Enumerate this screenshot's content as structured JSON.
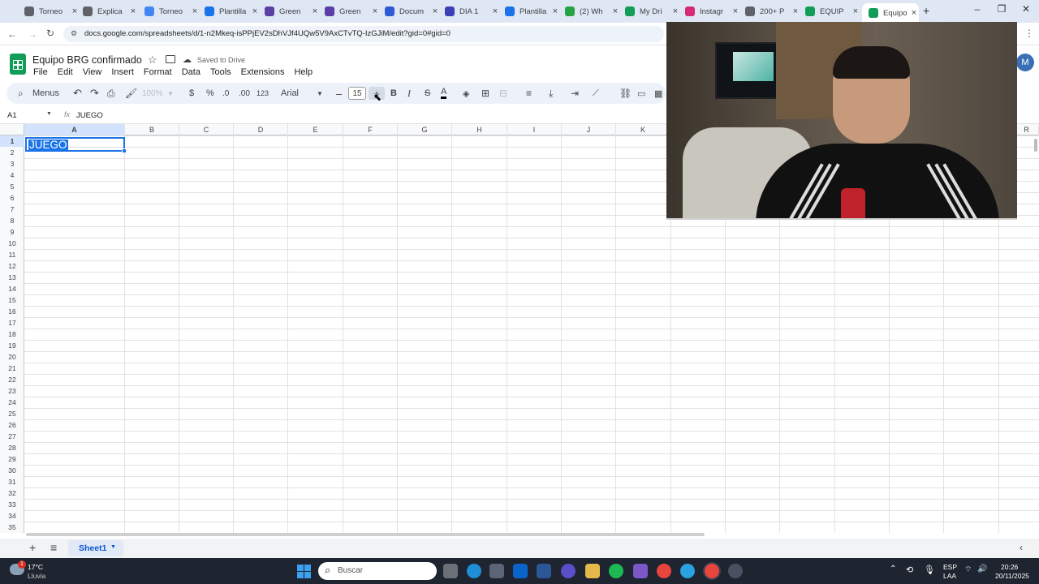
{
  "browser": {
    "tabs": [
      {
        "label": "Torneo",
        "color": "#5f6368"
      },
      {
        "label": "Explica",
        "color": "#5f6368"
      },
      {
        "label": "Torneo",
        "color": "#4285f4"
      },
      {
        "label": "Plantilla",
        "color": "#1a73e8"
      },
      {
        "label": "Green",
        "color": "#5b3fa6"
      },
      {
        "label": "Green",
        "color": "#5b3fa6"
      },
      {
        "label": "Docum",
        "color": "#2c5bd4"
      },
      {
        "label": "DIA 1",
        "color": "#3b3fb5"
      },
      {
        "label": "Plantilla",
        "color": "#1a73e8"
      },
      {
        "label": "(2) Wh",
        "color": "#25a244"
      },
      {
        "label": "My Dri",
        "color": "#0f9d58"
      },
      {
        "label": "Instagr",
        "color": "#d62976"
      },
      {
        "label": "200+ P",
        "color": "#5f6368"
      },
      {
        "label": "EQUIP",
        "color": "#0f9d58"
      },
      {
        "label": "Equipo",
        "color": "#0f9d58"
      }
    ],
    "new_tab": "+",
    "url": "docs.google.com/spreadsheets/d/1-n2Mkeq-isPPjEV2sDhVJf4UQw5V9AxCTvTQ-IzGJiM/edit?gid=0#gid=0"
  },
  "sheet": {
    "title": "Equipo BRG confirmado",
    "saved": "Saved to Drive",
    "menu": [
      "File",
      "Edit",
      "View",
      "Insert",
      "Format",
      "Data",
      "Tools",
      "Extensions",
      "Help"
    ]
  },
  "toolbar": {
    "search": "Menus",
    "zoom": "100%",
    "currency": "$",
    "percent": "%",
    "dec_less": ".0",
    "dec_more": ".00",
    "num_format": "123",
    "font": "Arial",
    "font_size": "15",
    "bold": "B",
    "italic": "I",
    "strike": "S",
    "text_color": "A"
  },
  "formula": {
    "cell_ref": "A1",
    "fx": "fx",
    "value": "JUEGO"
  },
  "columns": [
    "A",
    "B",
    "C",
    "D",
    "E",
    "F",
    "G",
    "H",
    "I",
    "J",
    "K",
    "R"
  ],
  "rows": [
    "1",
    "2",
    "3",
    "4",
    "5",
    "6",
    "7",
    "8",
    "9",
    "10",
    "11",
    "12",
    "13",
    "14",
    "15",
    "16",
    "17",
    "18",
    "19",
    "20",
    "21",
    "22",
    "23",
    "24",
    "25",
    "26",
    "27",
    "28",
    "29",
    "30",
    "31",
    "32",
    "33",
    "34",
    "35"
  ],
  "cells": {
    "A1": "JUEGO"
  },
  "sheet_tabs": {
    "active": "Sheet1"
  },
  "taskbar": {
    "weather_temp": "17°C",
    "weather_desc": "Lluvia",
    "weather_badge": "1",
    "search": "Buscar",
    "lang": "ESP",
    "region": "LAA",
    "time": "20:26",
    "date": "20/11/2025"
  },
  "avatar_letter": "M"
}
